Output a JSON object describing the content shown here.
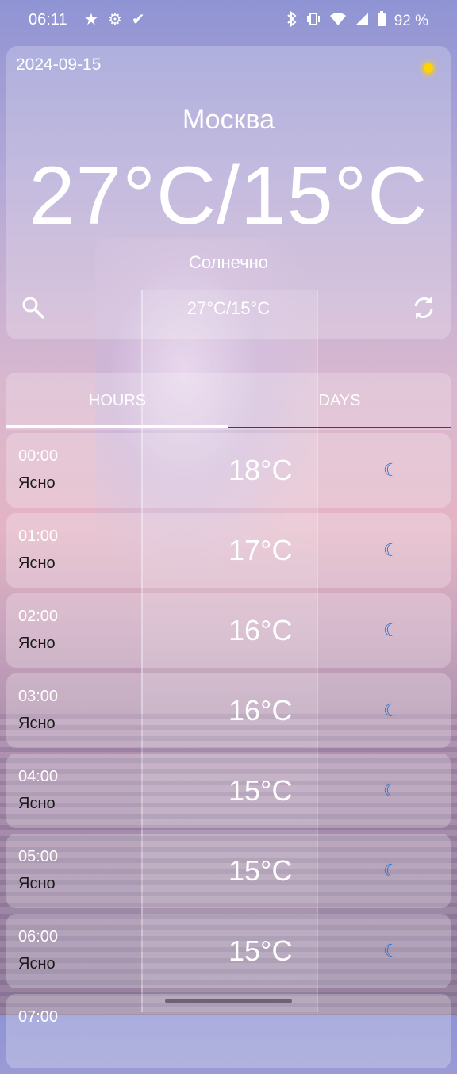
{
  "status_bar": {
    "time": "06:11",
    "left_icons": [
      "★",
      "⚙",
      "✔"
    ],
    "battery": "92 %"
  },
  "weather": {
    "date": "2024-09-15",
    "city": "Москва",
    "main_temp": "27°C/15°C",
    "condition": "Солнечно",
    "small_temp": "27°C/15°C",
    "sun_color": "#ffd200"
  },
  "tabs": {
    "hours": "HOURS",
    "days": "DAYS"
  },
  "hours": [
    {
      "time": "00:00",
      "desc": "Ясно",
      "temp": "18°C"
    },
    {
      "time": "01:00",
      "desc": "Ясно",
      "temp": "17°C"
    },
    {
      "time": "02:00",
      "desc": "Ясно",
      "temp": "16°C"
    },
    {
      "time": "03:00",
      "desc": "Ясно",
      "temp": "16°C"
    },
    {
      "time": "04:00",
      "desc": "Ясно",
      "temp": "15°C"
    },
    {
      "time": "05:00",
      "desc": "Ясно",
      "temp": "15°C"
    },
    {
      "time": "06:00",
      "desc": "Ясно",
      "temp": "15°C"
    },
    {
      "time": "07:00",
      "desc": "",
      "temp": ""
    }
  ],
  "icons": {
    "moon": "moon-icon",
    "search": "search-icon",
    "refresh": "refresh-icon",
    "sun": "sun-icon"
  }
}
